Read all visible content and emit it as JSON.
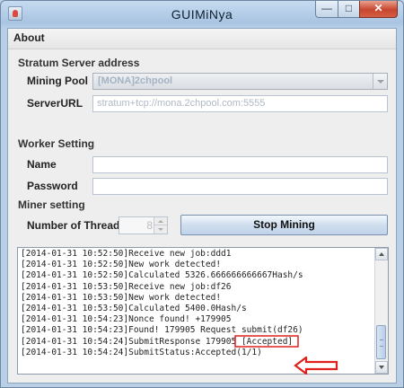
{
  "window": {
    "title": "GUIMiNya"
  },
  "menu": {
    "about": "About"
  },
  "stratum": {
    "heading": "Stratum Server address",
    "pool_label": "Mining Pool",
    "pool_value": "[MONA]2chpool",
    "url_label": "ServerURL",
    "url_value": "stratum+tcp://mona.2chpool.com:5555"
  },
  "worker": {
    "heading": "Worker Setting",
    "name_label": "Name",
    "name_value": "",
    "password_label": "Password",
    "password_value": ""
  },
  "miner": {
    "heading": "Miner setting",
    "threads_label": "Number of Thread",
    "threads_value": "8",
    "stop_button": "Stop Mining"
  },
  "log": {
    "lines": [
      "[2014-01-31 10:52:50]Receive new job:ddd1",
      "[2014-01-31 10:52:50]New work detected!",
      "[2014-01-31 10:52:50]Calculated 5326.666666666667Hash/s",
      "[2014-01-31 10:53:50]Receive new job:df26",
      "[2014-01-31 10:53:50]New work detected!",
      "[2014-01-31 10:53:50]Calculated 5400.0Hash/s",
      "[2014-01-31 10:54:23]Nonce found! +179905",
      "[2014-01-31 10:54:23]Found! 179905 Request submit(df26)",
      "[2014-01-31 10:54:24]SubmitResponse 179905 [Accepted]",
      "[2014-01-31 10:54:24]SubmitStatus:Accepted(1/1)"
    ],
    "highlight_box_color": "#e0201a",
    "highlight_arrow_color": "#e0201a"
  },
  "icons": {
    "app": "app-icon",
    "minimize": "minimize-icon",
    "maximize": "maximize-icon",
    "close": "close-icon"
  }
}
